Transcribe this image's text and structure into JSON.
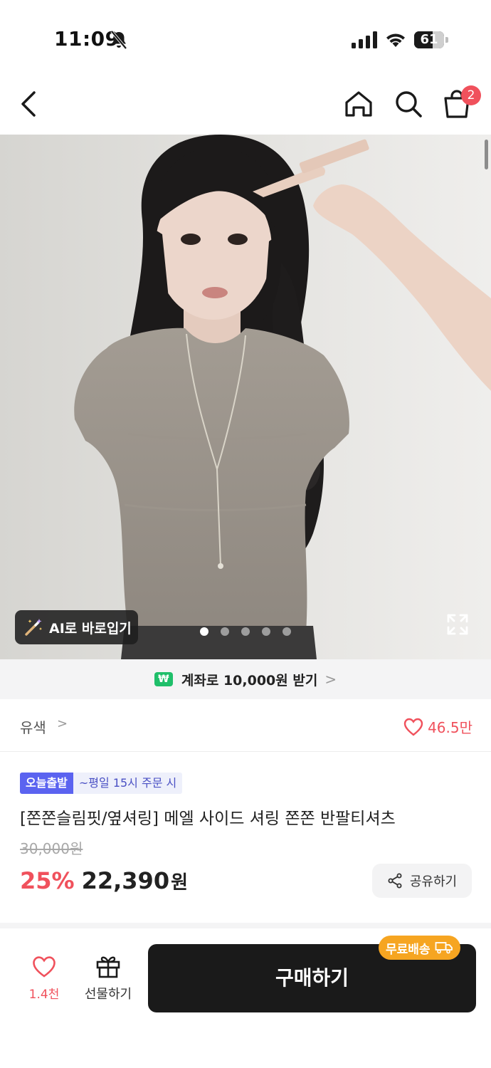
{
  "status_bar": {
    "time": "11:09",
    "battery": "61",
    "battery_level_percent": 61
  },
  "nav": {
    "cart_count": "2"
  },
  "gallery": {
    "ai_button_label": "AI로 바로입기",
    "page_count": 5,
    "active_page": 1
  },
  "promo": {
    "icon_text": "₩",
    "text": "계좌로 10,000원 받기",
    "chevron": ">"
  },
  "product": {
    "color": "유색",
    "color_chevron": ">",
    "like_count": "46.5만",
    "badge_today": "오늘출발",
    "badge_time": "~평일 15시 주문 시",
    "title": "[쫀쫀슬림핏/옆셔링] 메엘 사이드 셔링 쫀쫀 반팔티셔츠",
    "original_price": "30,000원",
    "discount": "25%",
    "sale_price": "22,390",
    "currency": "원",
    "share_label": "공유하기"
  },
  "bottom_bar": {
    "wish_count": "1.4천",
    "gift_label": "선물하기",
    "buy_label": "구매하기",
    "free_shipping_label": "무료배송"
  },
  "colors": {
    "accent_red": "#f0515c",
    "badge_blue": "#5b63f0",
    "promo_green": "#1fbf6a",
    "shipping_orange": "#f6a521",
    "buy_button": "#1a1a1a"
  }
}
